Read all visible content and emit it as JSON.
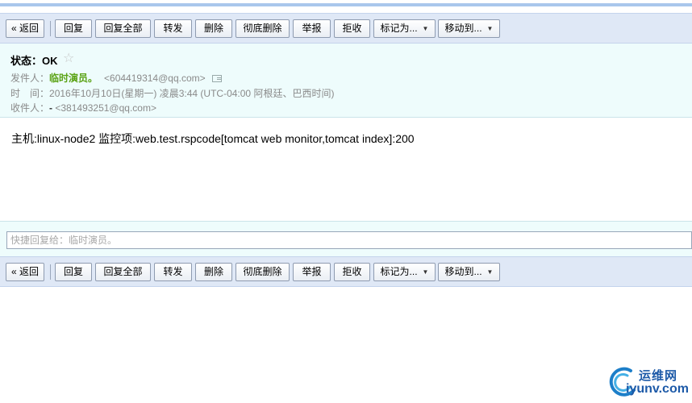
{
  "toolbar": {
    "back": "« 返回",
    "reply": "回复",
    "reply_all": "回复全部",
    "forward": "转发",
    "delete": "删除",
    "delete_permanently": "彻底删除",
    "report": "举报",
    "reject": "拒收",
    "mark_as": "标记为...",
    "move_to": "移动到..."
  },
  "email": {
    "subject": "状态：OK",
    "from_label": "发件人：",
    "from_name": "临时演员。",
    "from_address": "<604419314@qq.com>",
    "time_label": "时　间：",
    "time_value": "2016年10月10日(星期一) 凌晨3:44 (UTC-04:00 阿根廷、巴西时间)",
    "to_label": "收件人：",
    "to_name": "-",
    "to_address": "<381493251@qq.com>",
    "body": "主机:linux-node2 监控项:web.test.rspcode[tomcat web monitor,tomcat index]:200"
  },
  "quick_reply": {
    "placeholder": "快捷回复给：临时演员。"
  },
  "watermark": {
    "cn": "运维网",
    "en": "iyunv.com"
  },
  "colors": {
    "toolbar_bg": "#dfe8f6",
    "header_bg": "#eefcfc",
    "sender": "#5ba316",
    "watermark": "#1d5aa8"
  }
}
